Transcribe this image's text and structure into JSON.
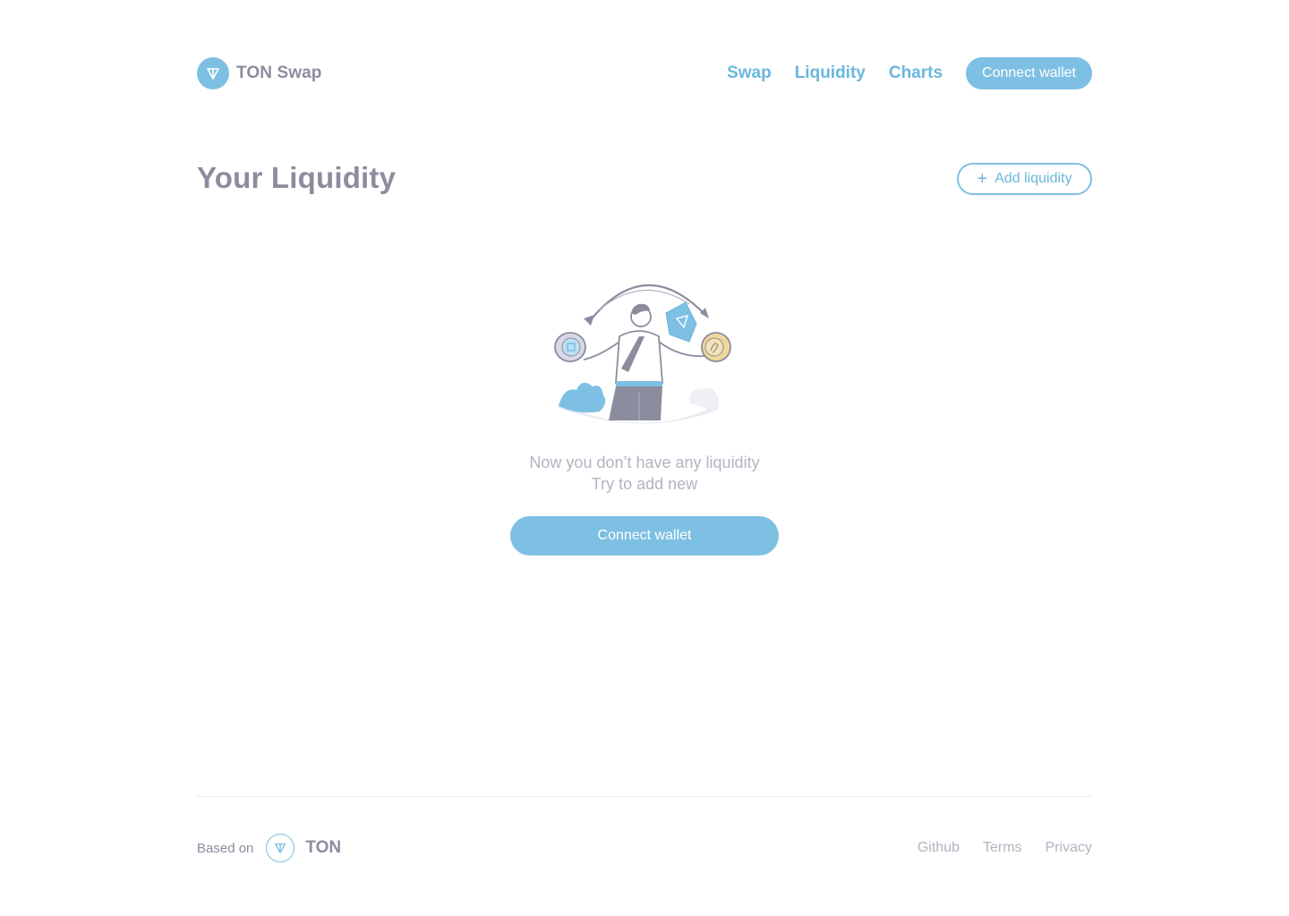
{
  "header": {
    "brand_name": "TON Swap",
    "nav": [
      {
        "label": "Swap"
      },
      {
        "label": "Liquidity"
      },
      {
        "label": "Charts"
      }
    ],
    "connect_wallet_label": "Connect wallet"
  },
  "main": {
    "title": "Your Liquidity",
    "add_liquidity_label": "Add liquidity",
    "empty_state": {
      "line1": "Now you don’t have any liquidity",
      "line2": "Try to add new",
      "connect_wallet_label": "Connect wallet"
    }
  },
  "footer": {
    "based_on_label": "Based on",
    "ton_label": "TON",
    "links": [
      {
        "label": "Github"
      },
      {
        "label": "Terms"
      },
      {
        "label": "Privacy"
      }
    ]
  },
  "colors": {
    "accent": "#7ec0e3",
    "accent_text": "#6bb6de",
    "heading": "#8b8d9e",
    "muted": "#b2b4c0"
  },
  "icons": {
    "brand": "ton-logo-icon",
    "add": "plus-icon",
    "illustration": "swap-illustration"
  }
}
